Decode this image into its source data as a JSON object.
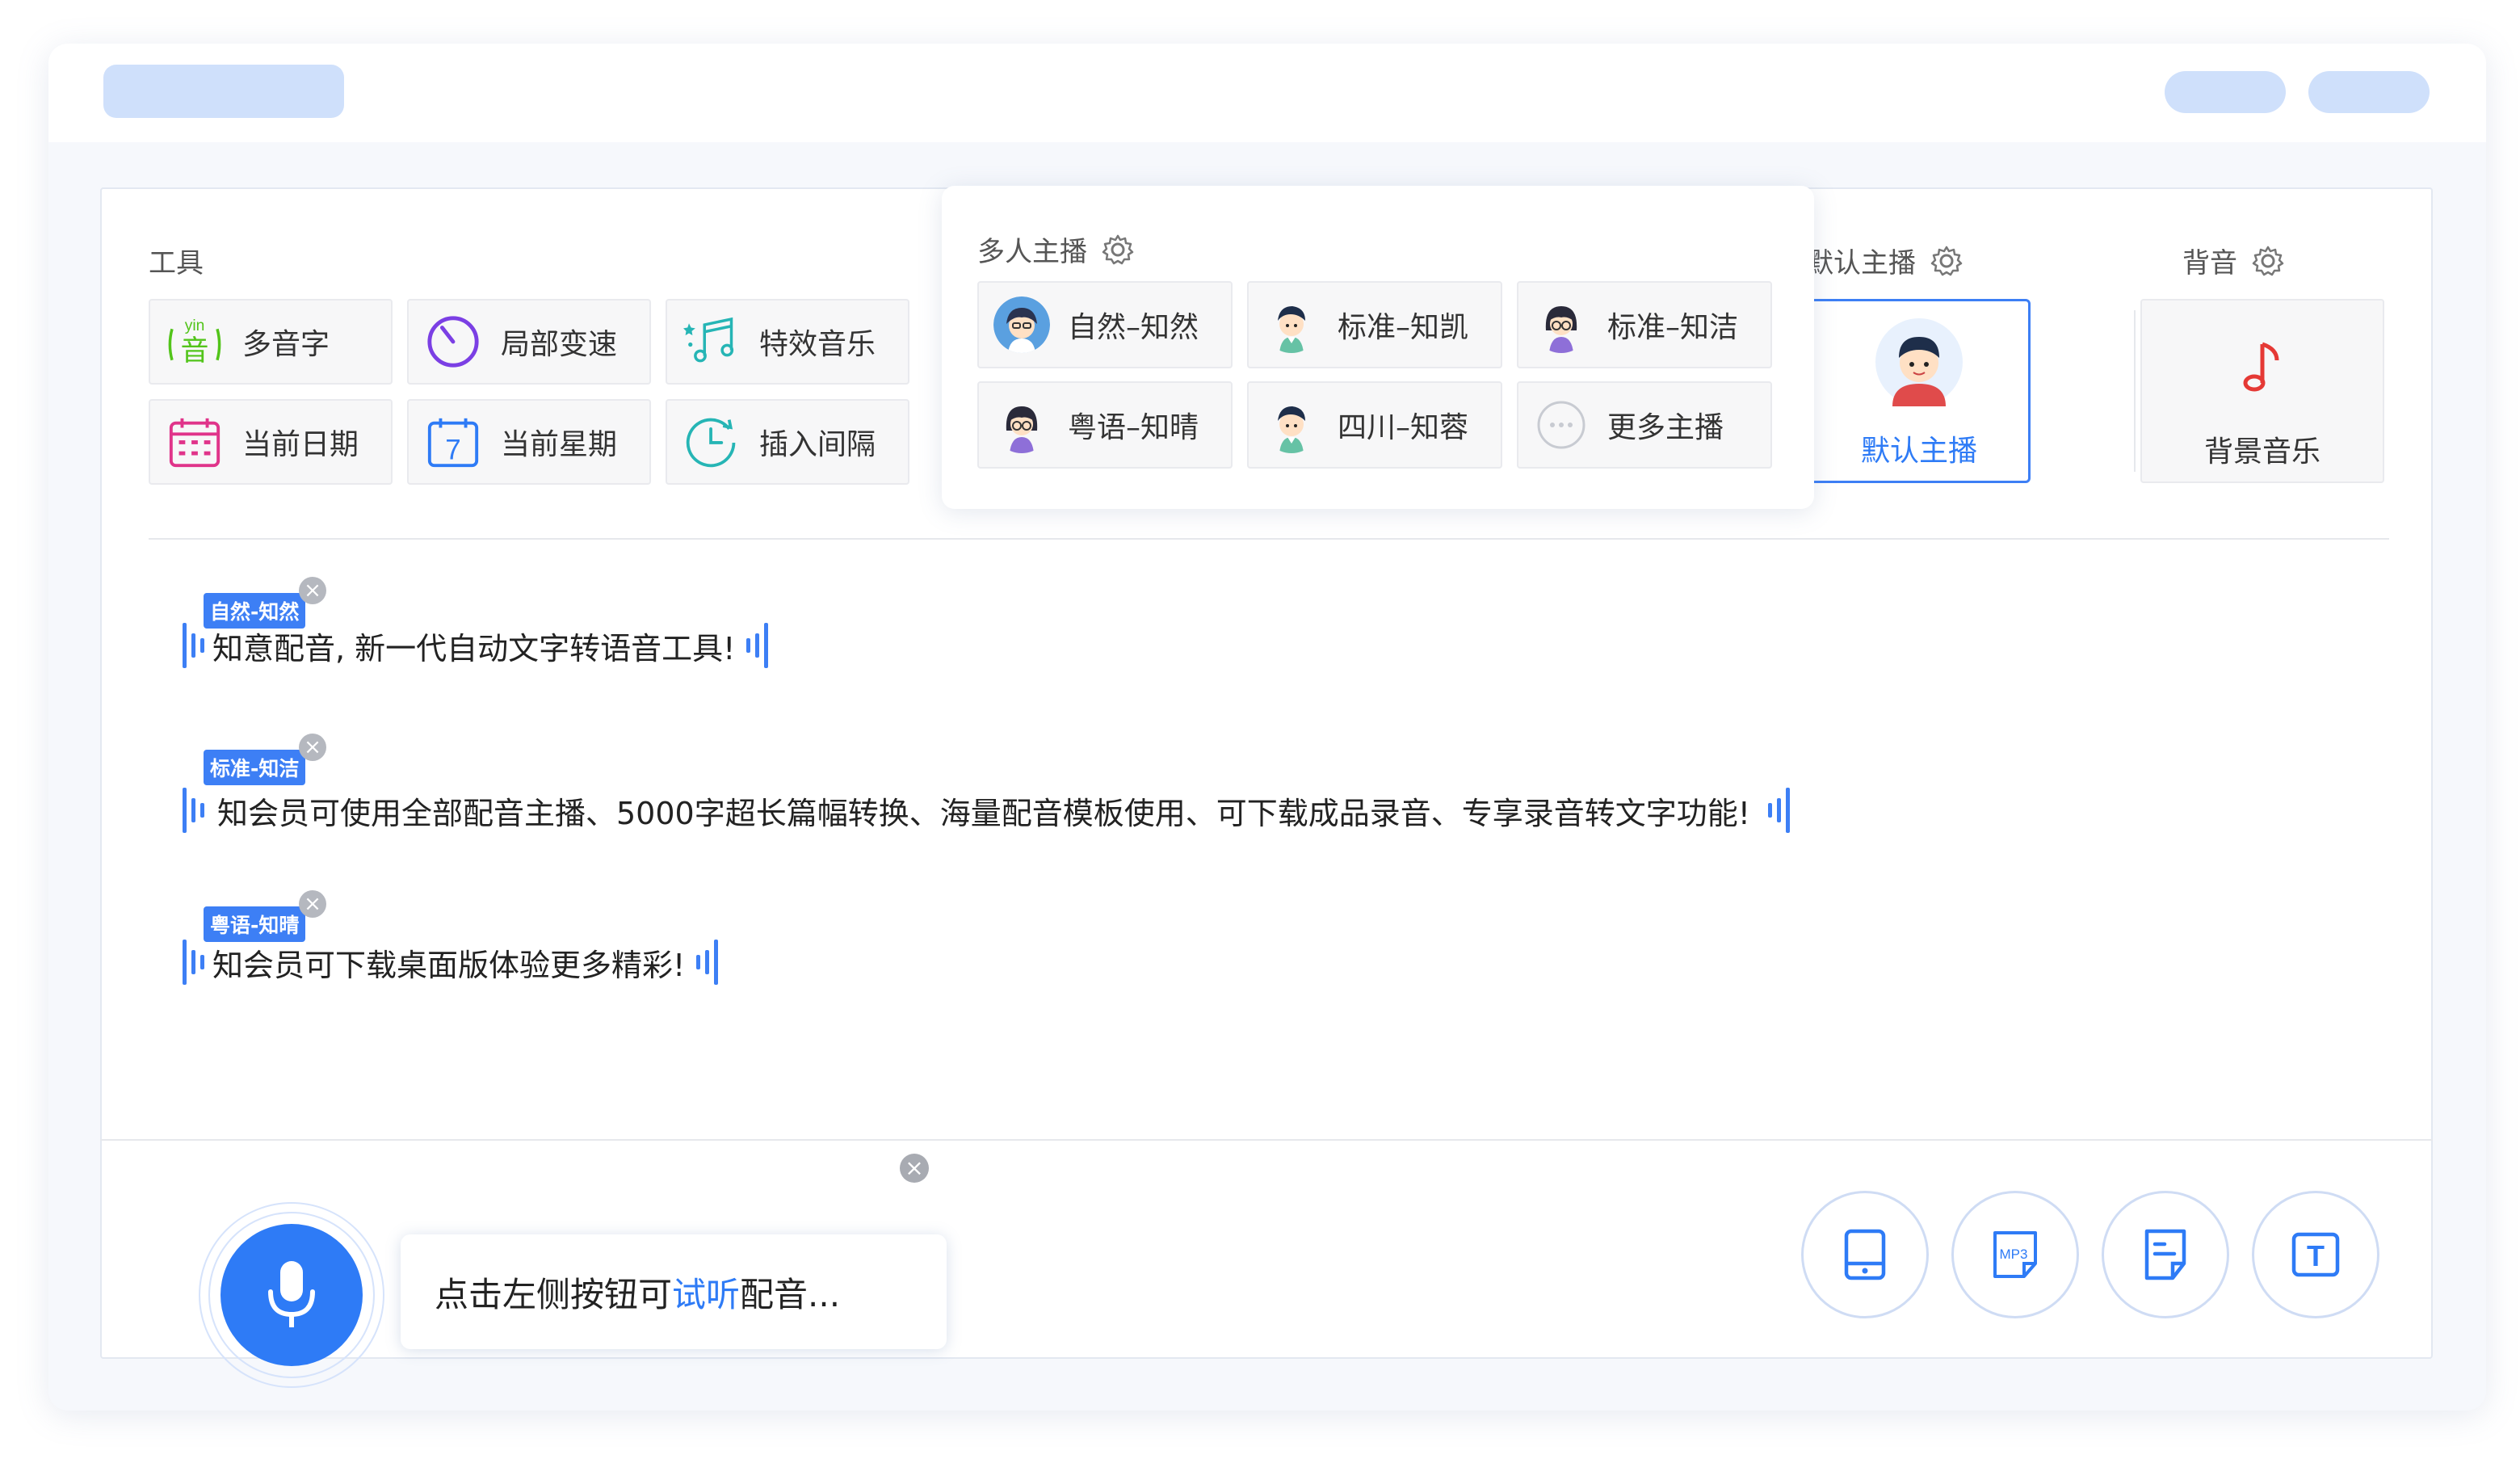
{
  "tools": {
    "title": "工具",
    "items": [
      {
        "label": "多音字",
        "icon": "polyphone-icon",
        "glyph_top": "yin",
        "glyph_main": "音"
      },
      {
        "label": "局部变速",
        "icon": "speed-dial-icon"
      },
      {
        "label": "特效音乐",
        "icon": "music-notes-icon"
      },
      {
        "label": "当前日期",
        "icon": "calendar-icon"
      },
      {
        "label": "当前星期",
        "icon": "calendar-week-icon",
        "glyph": "7"
      },
      {
        "label": "插入间隔",
        "icon": "clock-interval-icon"
      }
    ]
  },
  "multi_anchor": {
    "title": "多人主播",
    "items": [
      {
        "label": "自然–知然",
        "icon": "avatar-icon"
      },
      {
        "label": "标准–知凯",
        "icon": "avatar-icon"
      },
      {
        "label": "标准–知洁",
        "icon": "avatar-icon"
      },
      {
        "label": "粤语–知晴",
        "icon": "avatar-icon"
      },
      {
        "label": "四川–知蓉",
        "icon": "avatar-icon"
      },
      {
        "label": "更多主播",
        "icon": "more-dots-icon"
      }
    ]
  },
  "default_anchor": {
    "title": "默认主播",
    "card_label": "默认主播"
  },
  "background": {
    "title": "背音",
    "card_label": "背景音乐"
  },
  "segments": [
    {
      "tag": "自然-知然",
      "text": "知意配音, 新一代自动文字转语音工具!"
    },
    {
      "tag": "标准-知洁",
      "text": "知会员可使用全部配音主播、5000字超长篇幅转换、海量配音模板使用、可下载成品录音、专享录音转文字功能!"
    },
    {
      "tag": "粤语-知晴",
      "text": "知会员可下载桌面版体验更多精彩!"
    }
  ],
  "player": {
    "hint_prefix": "点击左侧按钮可",
    "hint_highlight": "试听",
    "hint_suffix": "配音...",
    "close_glyph": "×",
    "mp3_label": "MP3",
    "text_glyph": "T"
  },
  "colors": {
    "accent": "#2e7bf6",
    "placeholder": "#cfe0fb",
    "tag_bg": "#3d7ff5"
  }
}
